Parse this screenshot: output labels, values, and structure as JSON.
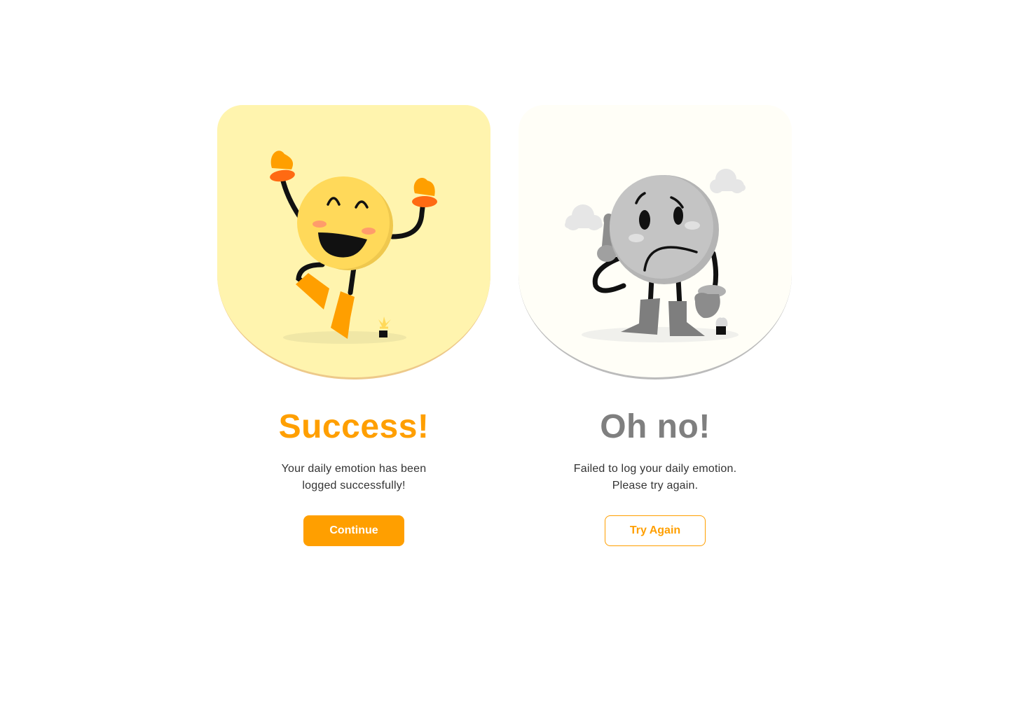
{
  "success": {
    "title": "Success!",
    "message_line1": "Your daily emotion has been",
    "message_line2": "logged successfully!",
    "button_label": "Continue"
  },
  "error": {
    "title": "Oh no!",
    "message_line1": "Failed to log your daily emotion.",
    "message_line2": "Please try again.",
    "button_label": "Try Again"
  },
  "colors": {
    "accent": "#FF9F00",
    "success_panel": "#FFF4AE",
    "error_panel": "#FFFEF7",
    "error_title": "#7F7F7F",
    "body_text": "#333333"
  },
  "icons": {
    "success_illustration": "happy-jumping-character-icon",
    "error_illustration": "sad-gray-character-icon"
  }
}
